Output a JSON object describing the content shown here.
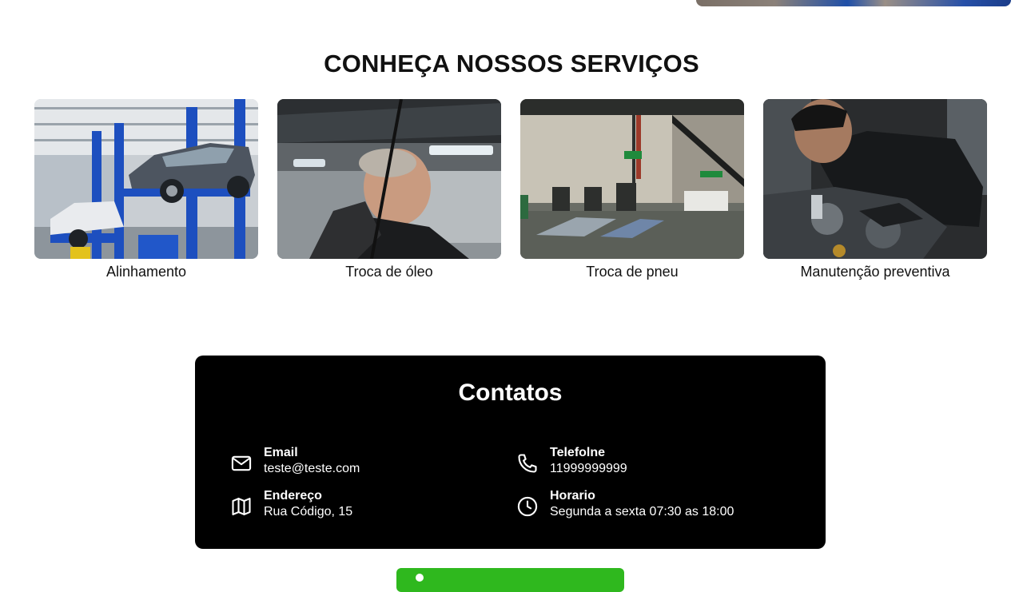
{
  "services": {
    "title": "CONHEÇA NOSSOS SERVIÇOS",
    "items": [
      {
        "label": "Alinhamento"
      },
      {
        "label": "Troca de óleo"
      },
      {
        "label": "Troca de pneu"
      },
      {
        "label": "Manutenção preventiva"
      }
    ]
  },
  "contacts": {
    "title": "Contatos",
    "email": {
      "label": "Email",
      "value": "teste@teste.com",
      "icon": "mail-icon"
    },
    "phone": {
      "label": "Telefolne",
      "value": "11999999999",
      "icon": "phone-icon"
    },
    "address": {
      "label": "Endereço",
      "value": "Rua Código, 15",
      "icon": "map-icon"
    },
    "hours": {
      "label": "Horario",
      "value": "Segunda a sexta 07:30 as 18:00",
      "icon": "clock-icon"
    }
  },
  "colors": {
    "background": "#ffffff",
    "contacts_bg": "#000000",
    "cta_green": "#2fb81e",
    "text": "#111111"
  }
}
